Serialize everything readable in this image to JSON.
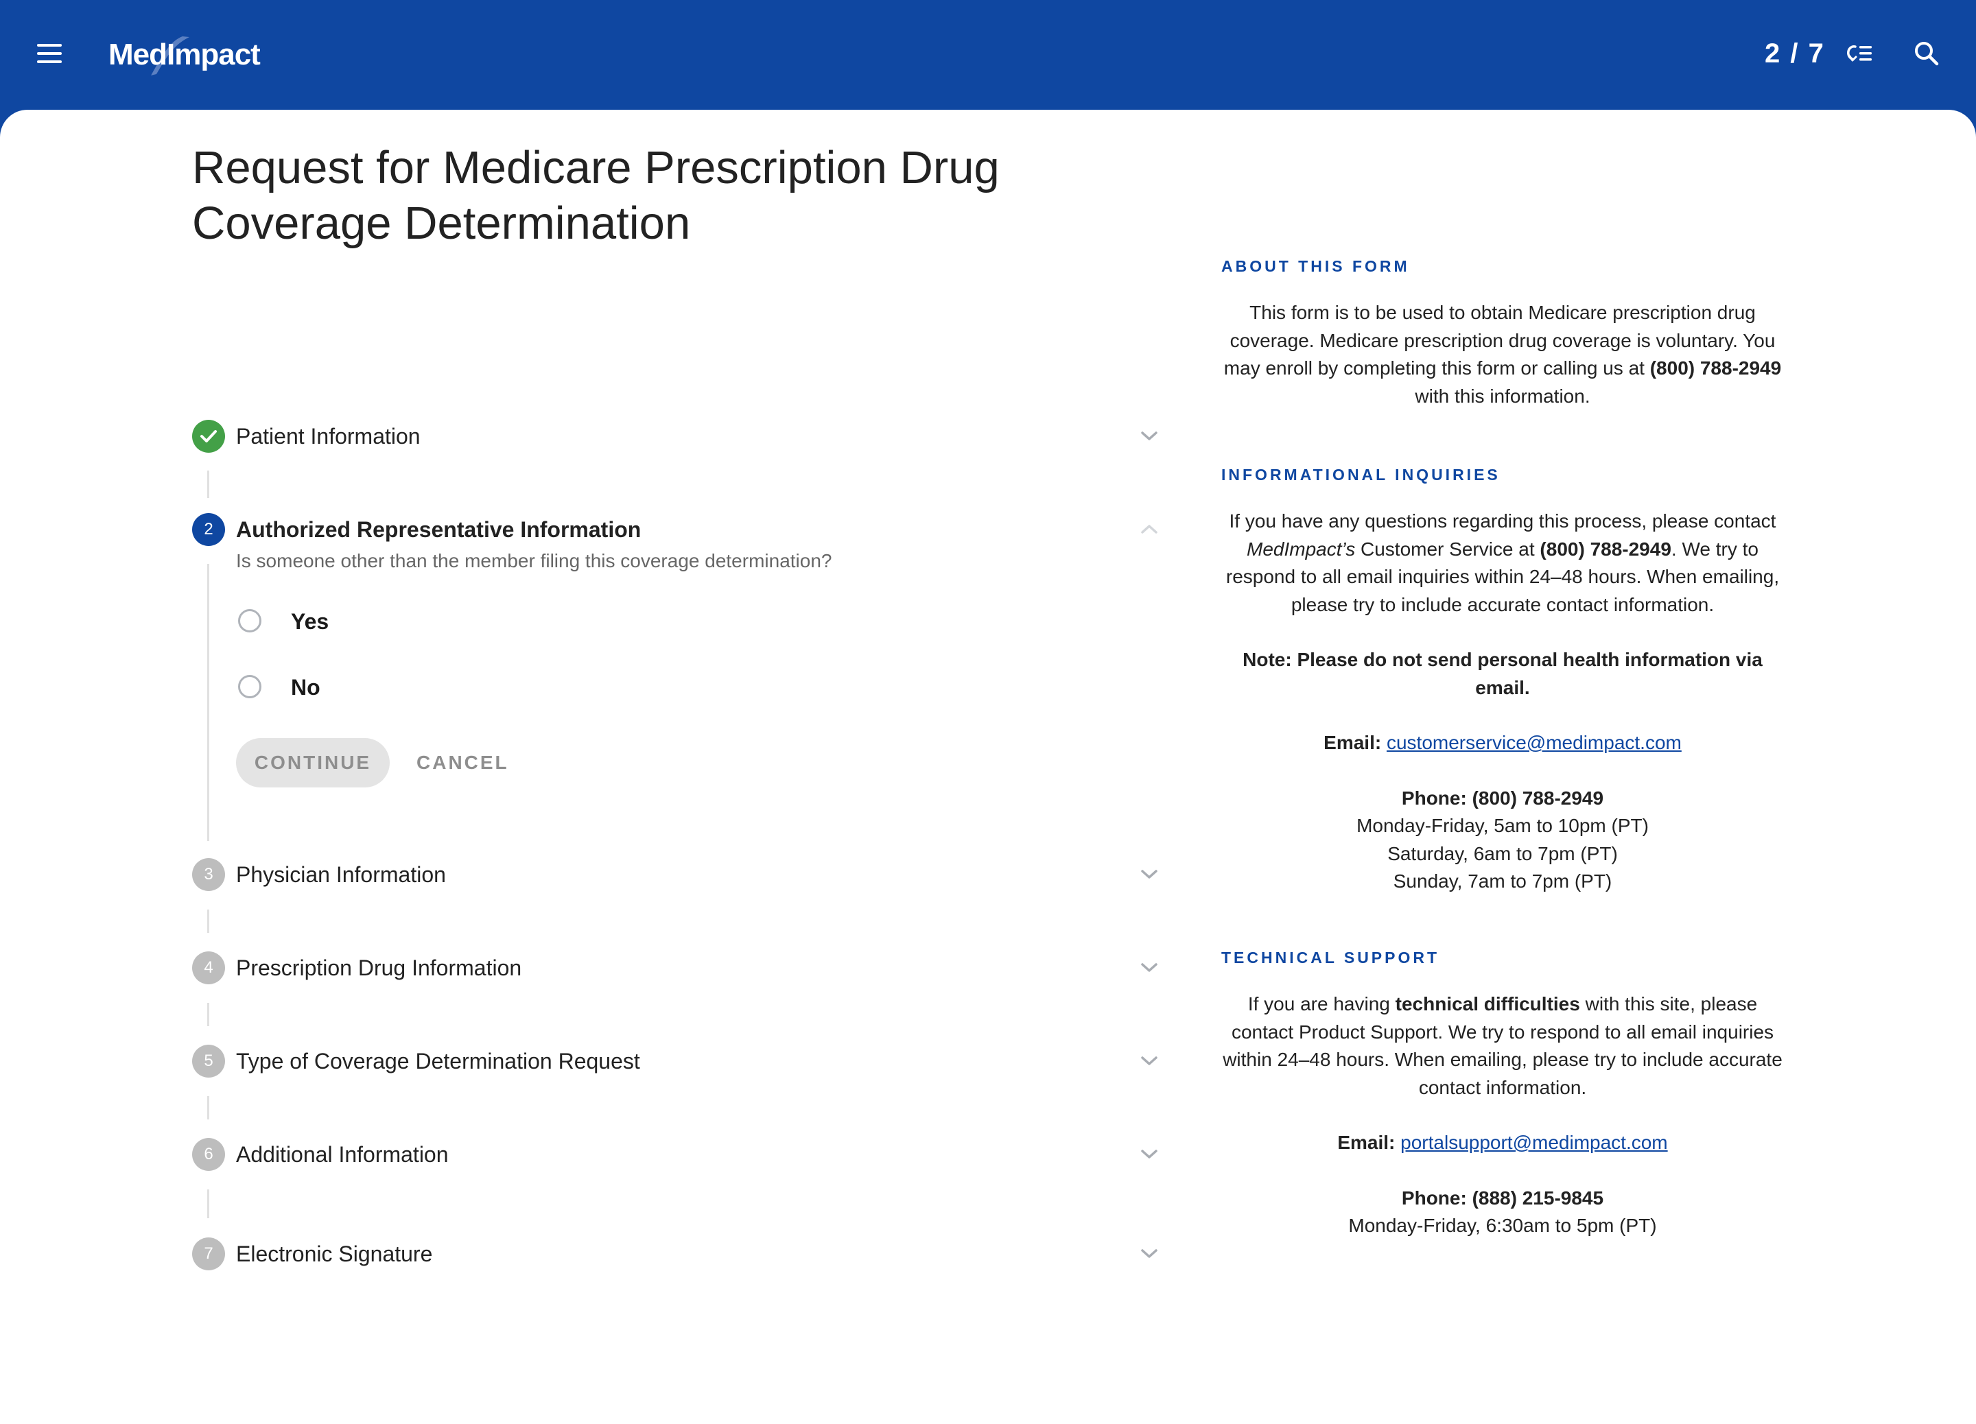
{
  "header": {
    "logo_text": "MedImpact",
    "progress": "2 / 7",
    "current_step": 2,
    "total_steps": 7,
    "brand_color": "#0F47A1"
  },
  "main": {
    "title": "Request for Medicare Prescription Drug Coverage Determination",
    "steps": [
      {
        "number": "1",
        "label": "Patient Information",
        "status": "completed"
      },
      {
        "number": "2",
        "label": "Authorized Representative Information",
        "status": "active",
        "question": "Is someone other than the member filing this coverage determination?",
        "options": [
          {
            "label": "Yes",
            "selected": false
          },
          {
            "label": "No",
            "selected": false
          }
        ],
        "continue_label": "CONTINUE",
        "cancel_label": "CANCEL"
      },
      {
        "number": "3",
        "label": "Physician Information",
        "status": "pending"
      },
      {
        "number": "4",
        "label": "Prescription Drug Information",
        "status": "pending"
      },
      {
        "number": "5",
        "label": "Type of Coverage Determination Request",
        "status": "pending"
      },
      {
        "number": "6",
        "label": "Additional Information",
        "status": "pending"
      },
      {
        "number": "7",
        "label": "Electronic Signature",
        "status": "pending"
      }
    ]
  },
  "sidebar": {
    "about": {
      "heading": "ABOUT THIS FORM",
      "text_1": "This form is to be used to obtain Medicare prescription drug coverage. Medicare prescription drug coverage is voluntary. You may enroll by completing this form or calling us at ",
      "phone_bold": "(800) 788-2949",
      "text_2": " with this information."
    },
    "inquiries": {
      "heading": "INFORMATIONAL INQUIRIES",
      "text_1": "If you have any questions regarding this process, please contact ",
      "company_italic": "MedImpact’s",
      "text_2": " Customer Service at ",
      "phone_bold": "(800) 788-2949",
      "text_3": ". We try to respond to all email inquiries within 24–48 hours. When emailing, please try to include accurate contact information.",
      "note": "Note: Please do not send personal health information via email.",
      "email_label": "Email:",
      "email": "customerservice@medimpact.com",
      "phone_label": "Phone: (800) 788-2949",
      "hours": [
        "Monday-Friday, 5am to 10pm (PT)",
        "Saturday, 6am to 7pm (PT)",
        "Sunday, 7am to 7pm (PT)"
      ]
    },
    "support": {
      "heading": "TECHNICAL SUPPORT",
      "text_1": "If you are having ",
      "bold": "technical difficulties",
      "text_2": " with this site, please contact Product Support. We try to respond to all email inquiries within 24–48 hours. When emailing, please try to include accurate contact information.",
      "email_label": "Email:",
      "email": "portalsupport@medimpact.com",
      "phone_label": "Phone: (888) 215-9845",
      "hours": [
        "Monday-Friday, 6:30am to 5pm (PT)"
      ]
    }
  }
}
